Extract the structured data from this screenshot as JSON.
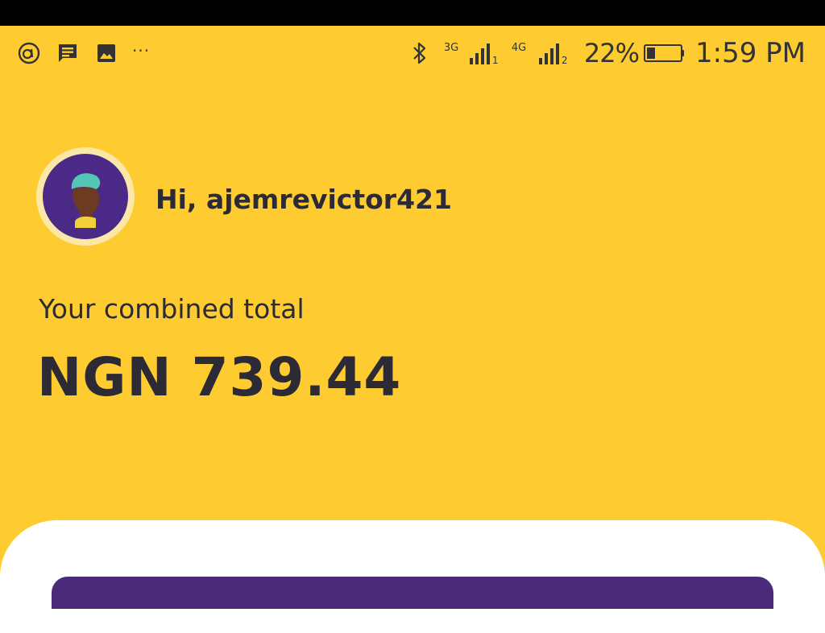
{
  "status_bar": {
    "left_icons": [
      "app-circle-icon",
      "message-icon",
      "image-icon"
    ],
    "more": "···",
    "signal_1": {
      "type": "3G",
      "sim": "1"
    },
    "signal_2": {
      "type": "4G",
      "sim": "2"
    },
    "battery": "22%",
    "time": "1:59 PM"
  },
  "user": {
    "greeting": "Hi, ajemrevictor421"
  },
  "balance": {
    "label": "Your combined total",
    "amount": "NGN 739.44"
  },
  "colors": {
    "background": "#fecc30",
    "text": "#2b2a35",
    "card": "#ffffff",
    "accent_purple": "#4b2a7a"
  }
}
